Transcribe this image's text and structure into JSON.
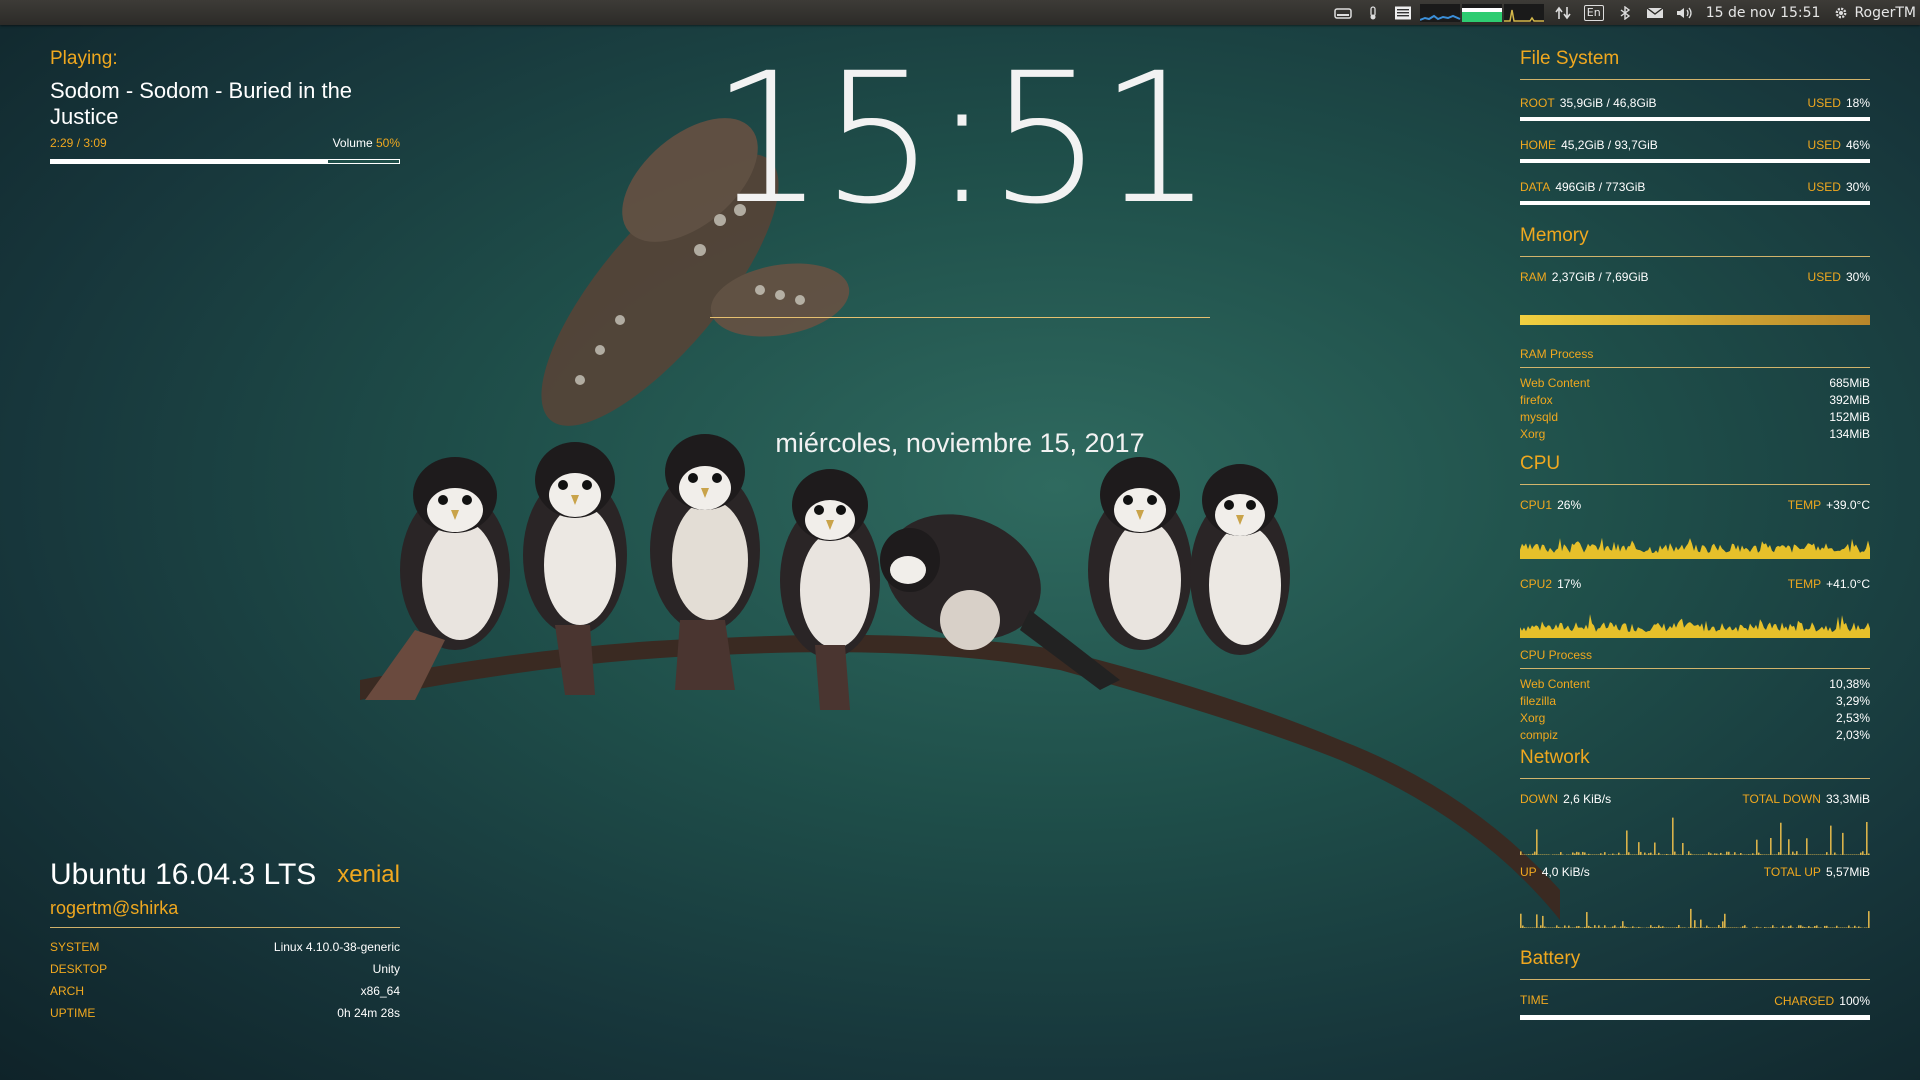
{
  "topbar": {
    "datetime": "15 de nov 15:51",
    "user": "RogerTM",
    "lang": "En"
  },
  "player": {
    "heading": "Playing:",
    "track": "Sodom - Sodom - Buried in the Justice",
    "time": "2:29 / 3:09",
    "volume_label": "Volume",
    "volume_value": "50%",
    "progress": 0.79
  },
  "clock": {
    "time": "15:51",
    "date": "miércoles, noviembre 15, 2017"
  },
  "system": {
    "os": "Ubuntu 16.04.3 LTS",
    "codename": "xenial",
    "user": "rogertm@shirka",
    "rows": [
      {
        "label": "SYSTEM",
        "value": "Linux 4.10.0-38-generic"
      },
      {
        "label": "DESKTOP",
        "value": "Unity"
      },
      {
        "label": "ARCH",
        "value": "x86_64"
      },
      {
        "label": "UPTIME",
        "value": "0h 24m 28s"
      }
    ]
  },
  "filesystem": {
    "title": "File System",
    "used_label": "USED",
    "entries": [
      {
        "name": "ROOT",
        "size": "35,9GiB / 46,8GiB",
        "used": "18%",
        "fraction": 0.18
      },
      {
        "name": "HOME",
        "size": "45,2GiB / 93,7GiB",
        "used": "46%",
        "fraction": 0.46
      },
      {
        "name": "DATA",
        "size": "496GiB / 773GiB",
        "used": "30%",
        "fraction": 0.3
      }
    ]
  },
  "memory": {
    "title": "Memory",
    "ram_label": "RAM",
    "ram_value": "2,37GiB / 7,69GiB",
    "used_label": "USED",
    "used_value": "30%",
    "process_title": "RAM Process",
    "processes": [
      {
        "name": "Web Content",
        "value": "685MiB"
      },
      {
        "name": "firefox",
        "value": "392MiB"
      },
      {
        "name": "mysqld",
        "value": "152MiB"
      },
      {
        "name": "Xorg",
        "value": "134MiB"
      }
    ]
  },
  "cpu": {
    "title": "CPU",
    "temp_label": "TEMP",
    "cores": [
      {
        "label": "CPU1",
        "usage": "26%",
        "temp": "+39.0°C"
      },
      {
        "label": "CPU2",
        "usage": "17%",
        "temp": "+41.0°C"
      }
    ],
    "process_title": "CPU Process",
    "processes": [
      {
        "name": "Web Content",
        "value": "10,38%"
      },
      {
        "name": "filezilla",
        "value": "3,29%"
      },
      {
        "name": "Xorg",
        "value": "2,53%"
      },
      {
        "name": "compiz",
        "value": "2,03%"
      }
    ]
  },
  "network": {
    "title": "Network",
    "down_label": "DOWN",
    "down_value": "2,6 KiB/s",
    "total_down_label": "TOTAL DOWN",
    "total_down_value": "33,3MiB",
    "up_label": "UP",
    "up_value": "4,0 KiB/s",
    "total_up_label": "TOTAL UP",
    "total_up_value": "5,57MiB"
  },
  "battery": {
    "title": "Battery",
    "time_label": "TIME",
    "status_label": "CHARGED",
    "status_value": "100%",
    "level": 1.0
  },
  "colors": {
    "accent": "#f0a81f",
    "bar": "#ffffff"
  }
}
